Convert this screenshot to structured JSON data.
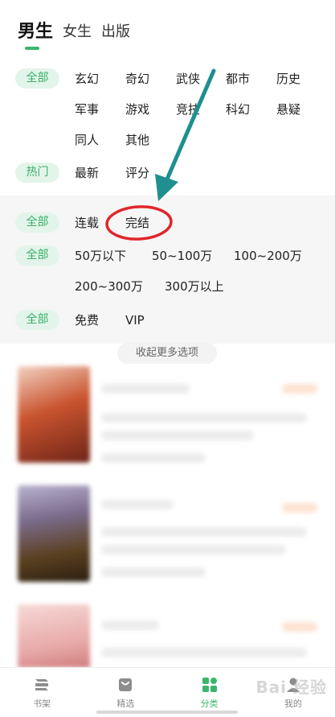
{
  "gender_tabs": [
    "男生",
    "女生",
    "出版"
  ],
  "filters": {
    "category": {
      "chip": "全部",
      "options": [
        "玄幻",
        "奇幻",
        "武侠",
        "都市",
        "历史",
        "军事",
        "游戏",
        "竞技",
        "科幻",
        "悬疑",
        "同人",
        "其他"
      ]
    },
    "sort": {
      "chip": "热门",
      "options": [
        "最新",
        "评分"
      ]
    },
    "status": {
      "chip": "全部",
      "options": [
        "连载",
        "完结"
      ]
    },
    "word_count": {
      "chip": "全部",
      "options": [
        "50万以下",
        "50~100万",
        "100~200万",
        "200~300万",
        "300万以上"
      ]
    },
    "price": {
      "chip": "全部",
      "options": [
        "免费",
        "VIP"
      ]
    }
  },
  "collapse_label": "收起更多选项",
  "nav": {
    "items": [
      {
        "label": "书架",
        "icon": "bookshelf-icon"
      },
      {
        "label": "精选",
        "icon": "featured-icon"
      },
      {
        "label": "分类",
        "icon": "category-icon"
      },
      {
        "label": "我的",
        "icon": "profile-icon"
      }
    ],
    "active_index": 2
  },
  "watermark": "Bai 经验",
  "colors": {
    "accent": "#3bb56d",
    "chip_bg": "#e3f5ea",
    "annotation_arrow": "#1f8f8f",
    "annotation_circle": "#e0262b"
  }
}
